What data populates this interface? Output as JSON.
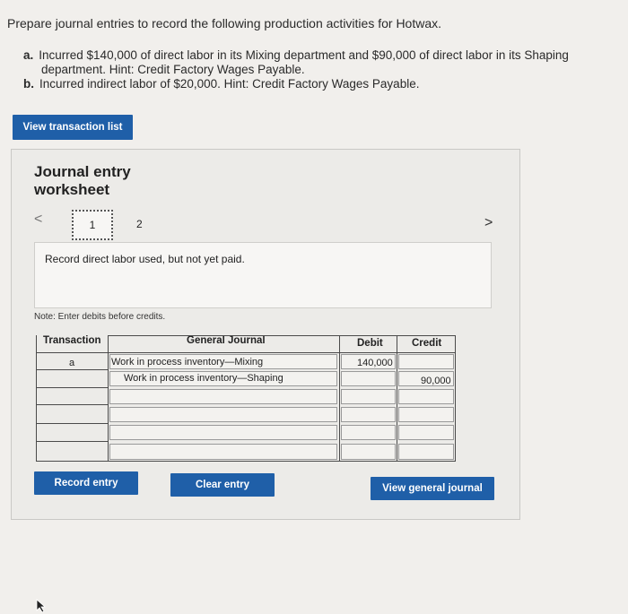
{
  "prompt": "Prepare journal entries to record the following production activities for Hotwax.",
  "items": [
    {
      "label": "a.",
      "line1": "Incurred $140,000 of direct labor in its Mixing department and $90,000 of direct labor in its Shaping",
      "line2": "department. Hint: Credit Factory Wages Payable."
    },
    {
      "label": "b.",
      "line1": "Incurred indirect labor of $20,000. Hint: Credit Factory Wages Payable."
    }
  ],
  "buttons": {
    "view_transactions": "View transaction list",
    "record": "Record entry",
    "clear": "Clear entry",
    "view_general_journal": "View general journal"
  },
  "worksheet": {
    "title_line1": "Journal entry",
    "title_line2": "worksheet",
    "pages": [
      "1",
      "2"
    ],
    "prev_icon": "<",
    "next_icon": ">",
    "description": "Record direct labor used, but not yet paid.",
    "note": "Note: Enter debits before credits."
  },
  "table": {
    "headers": {
      "transaction": "Transaction",
      "journal": "General Journal",
      "debit": "Debit",
      "credit": "Credit"
    },
    "rows": [
      {
        "transaction": "a",
        "account": "Work in process inventory—Mixing",
        "debit": "140,000",
        "credit": ""
      },
      {
        "transaction": "",
        "account": "Work in process inventory—Shaping",
        "debit": "",
        "credit": "90,000"
      },
      {
        "transaction": "",
        "account": "",
        "debit": "",
        "credit": ""
      },
      {
        "transaction": "",
        "account": "",
        "debit": "",
        "credit": ""
      },
      {
        "transaction": "",
        "account": "",
        "debit": "",
        "credit": ""
      },
      {
        "transaction": "",
        "account": "",
        "debit": "",
        "credit": ""
      }
    ]
  },
  "colors": {
    "button_blue": "#1f5fa8",
    "panel_bg": "#ecebe8"
  },
  "icons": {
    "prev": "chevron-left-icon",
    "next": "chevron-right-icon",
    "cursor": "mouse-pointer-icon"
  }
}
